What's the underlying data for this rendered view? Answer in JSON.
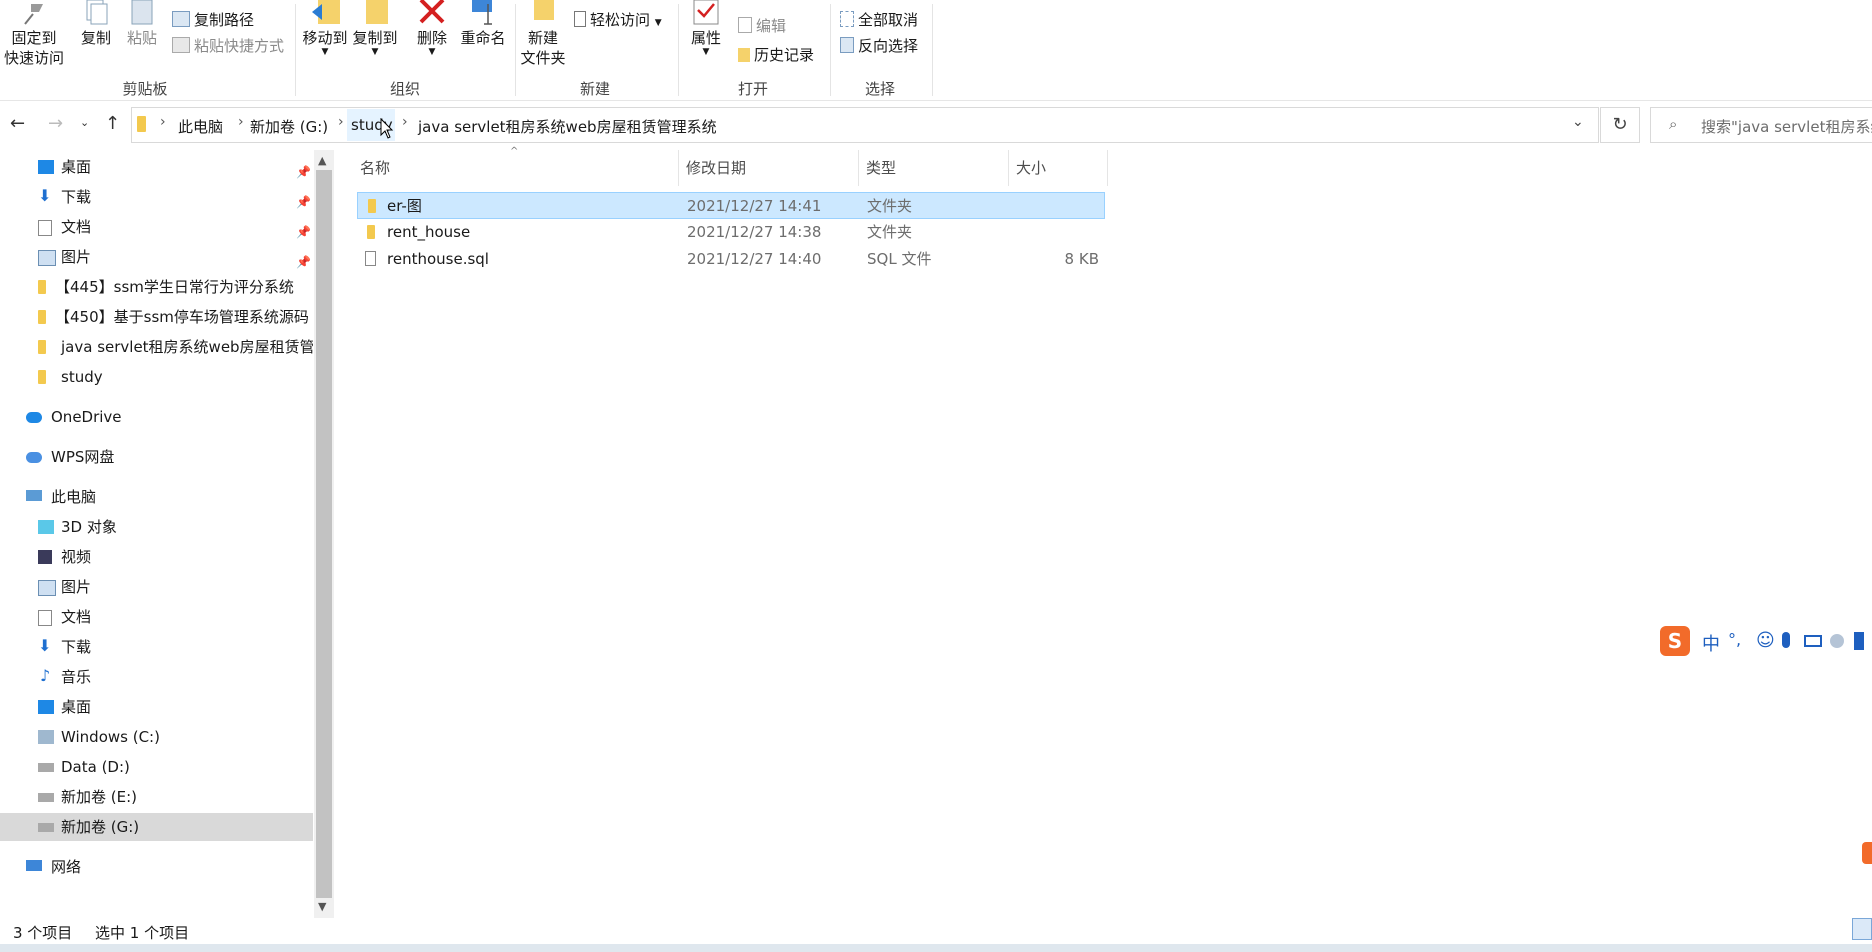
{
  "ribbon": {
    "clipboard": {
      "pin_label": "固定到\n快速访问",
      "copy_label": "复制",
      "paste_label": "粘贴",
      "copy_path": "复制路径",
      "paste_shortcut": "粘贴快捷方式",
      "group_label": "剪贴板"
    },
    "organize": {
      "move_to": "移动到",
      "copy_to": "复制到",
      "delete": "删除",
      "rename": "重命名",
      "group_label": "组织"
    },
    "new": {
      "new_folder": "新建\n文件夹",
      "easy_access": "轻松访问",
      "group_label": "新建"
    },
    "open": {
      "properties": "属性",
      "edit": "编辑",
      "history": "历史记录",
      "group_label": "打开"
    },
    "select": {
      "select_none": "全部取消",
      "invert": "反向选择",
      "group_label": "选择"
    }
  },
  "address": {
    "crumbs": [
      "此电脑",
      "新加卷 (G:)",
      "study",
      "java servlet租房系统web房屋租赁管理系统"
    ],
    "search_placeholder": "搜索\"java servlet租房系统"
  },
  "nav": {
    "quick": [
      {
        "label": "桌面",
        "pinned": true
      },
      {
        "label": "下载",
        "pinned": true
      },
      {
        "label": "文档",
        "pinned": true
      },
      {
        "label": "图片",
        "pinned": true
      },
      {
        "label": "【445】ssm学生日常行为评分系统"
      },
      {
        "label": "【450】基于ssm停车场管理系统源码"
      },
      {
        "label": "java servlet租房系统web房屋租赁管理系统"
      },
      {
        "label": "study"
      }
    ],
    "onedrive": "OneDrive",
    "wps": "WPS网盘",
    "thispc": "此电脑",
    "pc_items": [
      "3D 对象",
      "视频",
      "图片",
      "文档",
      "下载",
      "音乐",
      "桌面",
      "Windows (C:)",
      "Data (D:)",
      "新加卷 (E:)",
      "新加卷 (G:)"
    ],
    "network": "网络"
  },
  "columns": {
    "name": "名称",
    "modified": "修改日期",
    "type": "类型",
    "size": "大小"
  },
  "files": [
    {
      "name": "er-图",
      "modified": "2021/12/27 14:41",
      "type": "文件夹",
      "size": "",
      "kind": "folder",
      "selected": true
    },
    {
      "name": "rent_house",
      "modified": "2021/12/27 14:38",
      "type": "文件夹",
      "size": "",
      "kind": "folder",
      "selected": false
    },
    {
      "name": "renthouse.sql",
      "modified": "2021/12/27 14:40",
      "type": "SQL 文件",
      "size": "8 KB",
      "kind": "file",
      "selected": false
    }
  ],
  "status": {
    "count": "3 个项目",
    "selected": "选中 1 个项目"
  },
  "ime": {
    "lang": "中",
    "punct": "°,"
  }
}
